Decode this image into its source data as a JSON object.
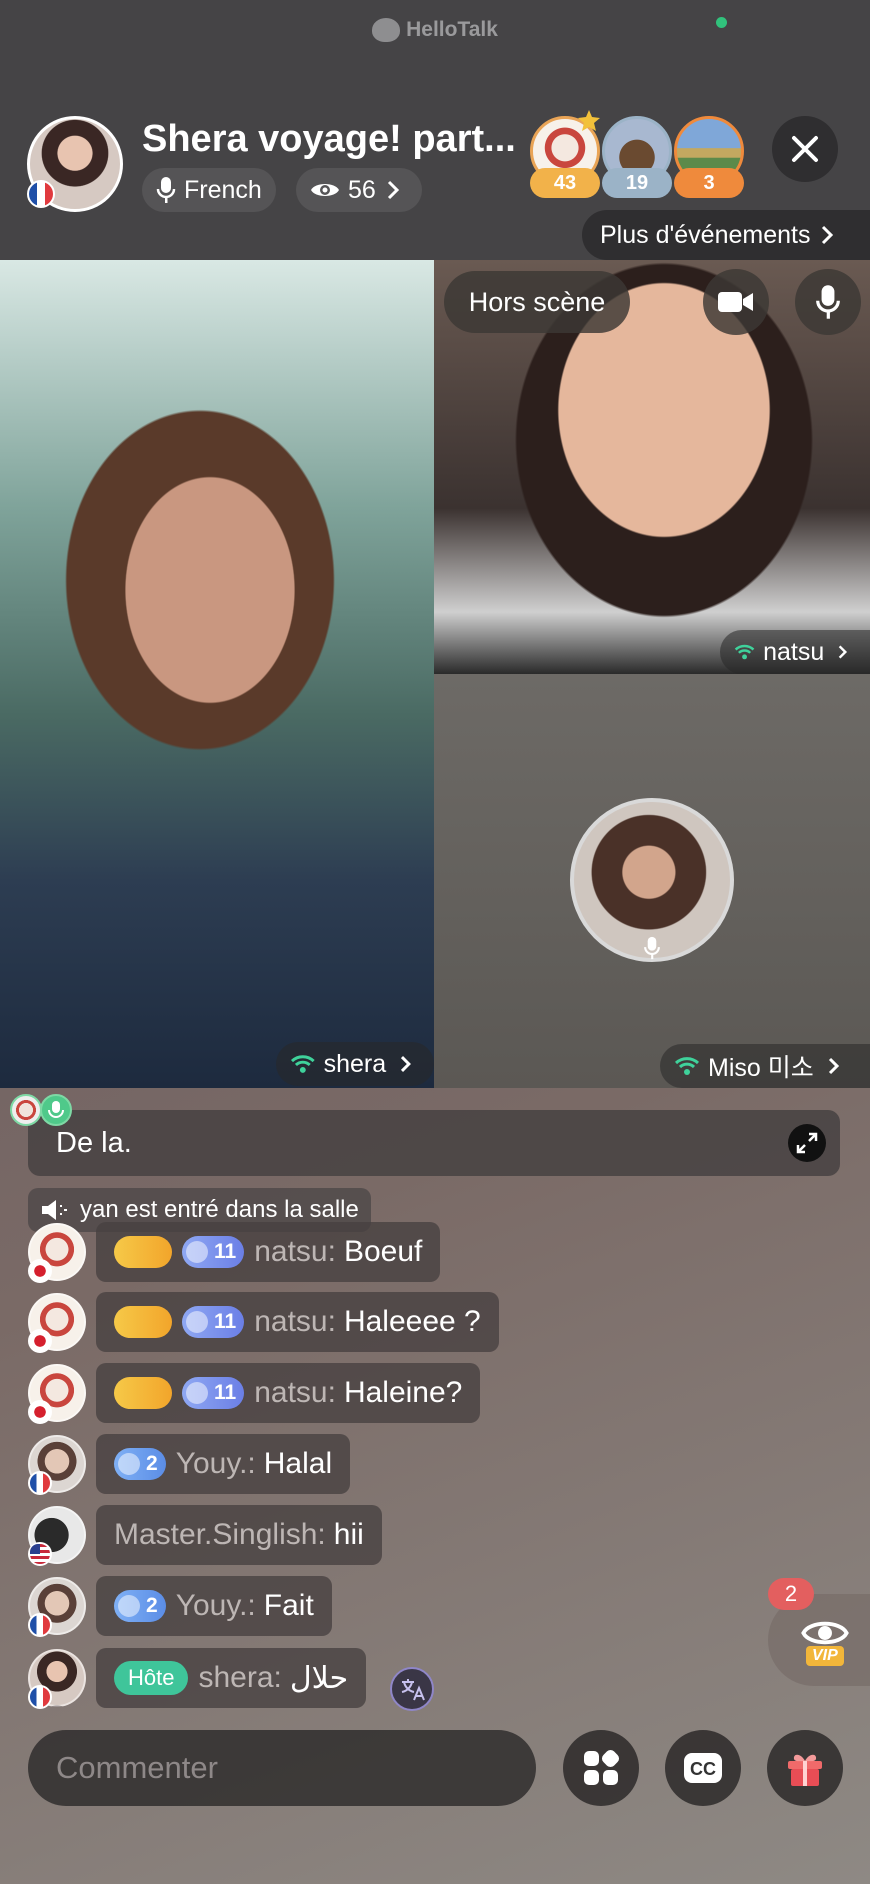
{
  "app": {
    "brand": "HelloTalk"
  },
  "room": {
    "title": "Shera voyage! part...",
    "language": "French",
    "viewers": "56",
    "events_label": "Plus d'événements"
  },
  "top_avatars": [
    {
      "count": "43",
      "badge_color": "#f2b24a"
    },
    {
      "count": "19",
      "badge_color": "#9bb3c7"
    },
    {
      "count": "3",
      "badge_color": "#ef8a3c"
    }
  ],
  "stage": {
    "offstage_label": "Hors scène",
    "speakers": {
      "main": "shera",
      "second": "natsu",
      "third": "Miso 미소"
    }
  },
  "subtitle": {
    "text": "De la."
  },
  "notice": {
    "text": "yan est entré dans la salle"
  },
  "messages": [
    {
      "user": "natsu:",
      "text": "Boeuf",
      "level": "11",
      "flag": "jp"
    },
    {
      "user": "natsu:",
      "text": "Haleeee ?",
      "level": "11",
      "flag": "jp"
    },
    {
      "user": "natsu:",
      "text": "Haleine?",
      "level": "11",
      "flag": "jp"
    },
    {
      "user": "Youy.:",
      "text": "Halal",
      "level": "2",
      "flag": "fr"
    },
    {
      "user": "Master.Singlish:",
      "text": "hii",
      "flag": "us"
    },
    {
      "user": "Youy.:",
      "text": "Fait",
      "level": "2",
      "flag": "fr"
    },
    {
      "user": "shera:",
      "text": "حلال",
      "role": "Hôte",
      "flag": "fr"
    }
  ],
  "vip": {
    "count": "2",
    "label": "VIP"
  },
  "composer": {
    "placeholder": "Commenter"
  },
  "colors": {
    "accent_green": "#31c27c",
    "host_badge": "#3fc59a",
    "vip_badge": "#e35f5f"
  }
}
